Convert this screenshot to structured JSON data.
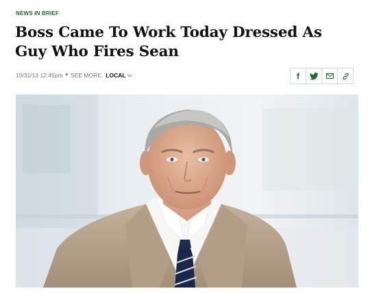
{
  "article": {
    "section_label": "NEWS IN BRIEF",
    "headline": "Boss Came To Work Today Dressed As Guy Who Fires Sean",
    "timestamp": "10/31/13 12:45pm",
    "see_more_label": "SEE MORE:",
    "topic": "LOCAL"
  },
  "share": {
    "buttons": [
      {
        "icon": "facebook-icon",
        "glyph": "f",
        "color": "#1e6b35"
      },
      {
        "icon": "twitter-icon",
        "color": "#1e6b35"
      },
      {
        "icon": "email-icon",
        "color": "#1e6b35"
      },
      {
        "icon": "link-icon",
        "color": "#1e6b35"
      }
    ]
  },
  "photo": {
    "subject": "gray-haired man in a tan suit, white shirt and striped navy tie"
  },
  "colors": {
    "accent": "#1e6b35",
    "text": "#111111",
    "meta": "#777777",
    "suit": "#b9a58f",
    "tie": "#1b2747"
  }
}
